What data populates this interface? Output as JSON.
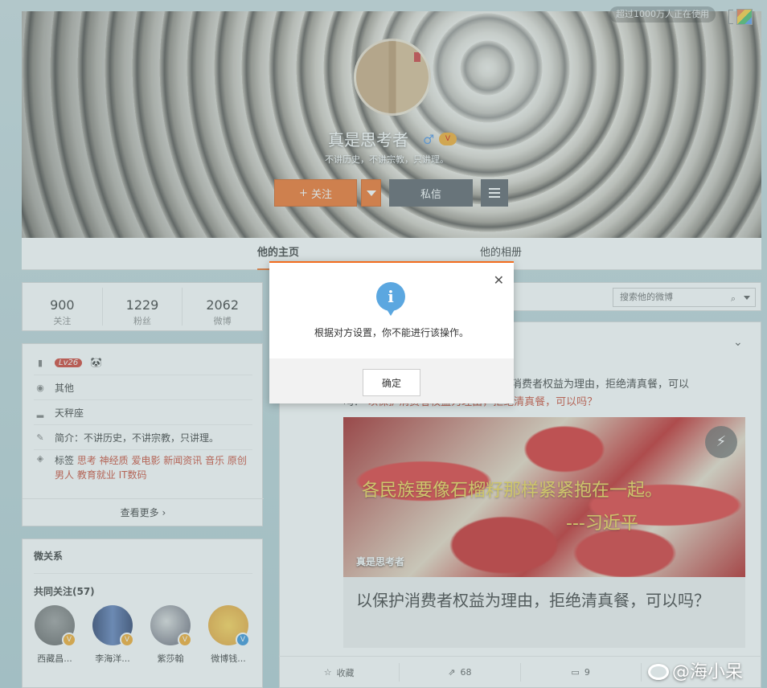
{
  "top_badge": "超过1000万人正在使用",
  "profile": {
    "name": "真是思考者",
    "bio": "不讲历史，不讲宗教，只讲理。",
    "follow_label": "关注",
    "message_label": "私信"
  },
  "tabs": [
    "他的主页",
    "他的相册"
  ],
  "stats": [
    {
      "value": "900",
      "label": "关注"
    },
    {
      "value": "1229",
      "label": "粉丝"
    },
    {
      "value": "2062",
      "label": "微博"
    }
  ],
  "info": {
    "level": "Lv26",
    "location": "其他",
    "zodiac": "天秤座",
    "intro": "简介：不讲历史，不讲宗教，只讲理。",
    "tags_label": "标签",
    "tags_line1": "思考 神经质 爱电影 新闻资讯 音乐 原创",
    "tags_line2": "男人 教育就业 IT数码",
    "more": "查看更多"
  },
  "relations": {
    "title": "微关系",
    "common_title": "共同关注(57)",
    "friends": [
      {
        "name": "西藏昌..."
      },
      {
        "name": "李海洋..."
      },
      {
        "name": "紫莎翰"
      },
      {
        "name": "微博钱..."
      }
    ]
  },
  "search": {
    "placeholder": "搜索他的微博"
  },
  "post": {
    "text_part1": "护消费者权益为理由，拒绝清真餐，可以",
    "text_part2": "吗？",
    "link_text": "以保护消费者权益为理由，拒绝清真餐，可以吗？",
    "image_caption1": "各民族要像石榴籽那样紧紧抱在一起。",
    "image_caption2": "---习近平",
    "image_owner": "真是思考者",
    "image_title": "以保护消费者权益为理由，拒绝清真餐，可以吗？",
    "actions": {
      "fav": "收藏",
      "repost": "68",
      "comment": "9"
    }
  },
  "dialog": {
    "message": "根据对方设置，你不能进行该操作。",
    "ok_label": "确定"
  },
  "watermark": "@海小呆"
}
